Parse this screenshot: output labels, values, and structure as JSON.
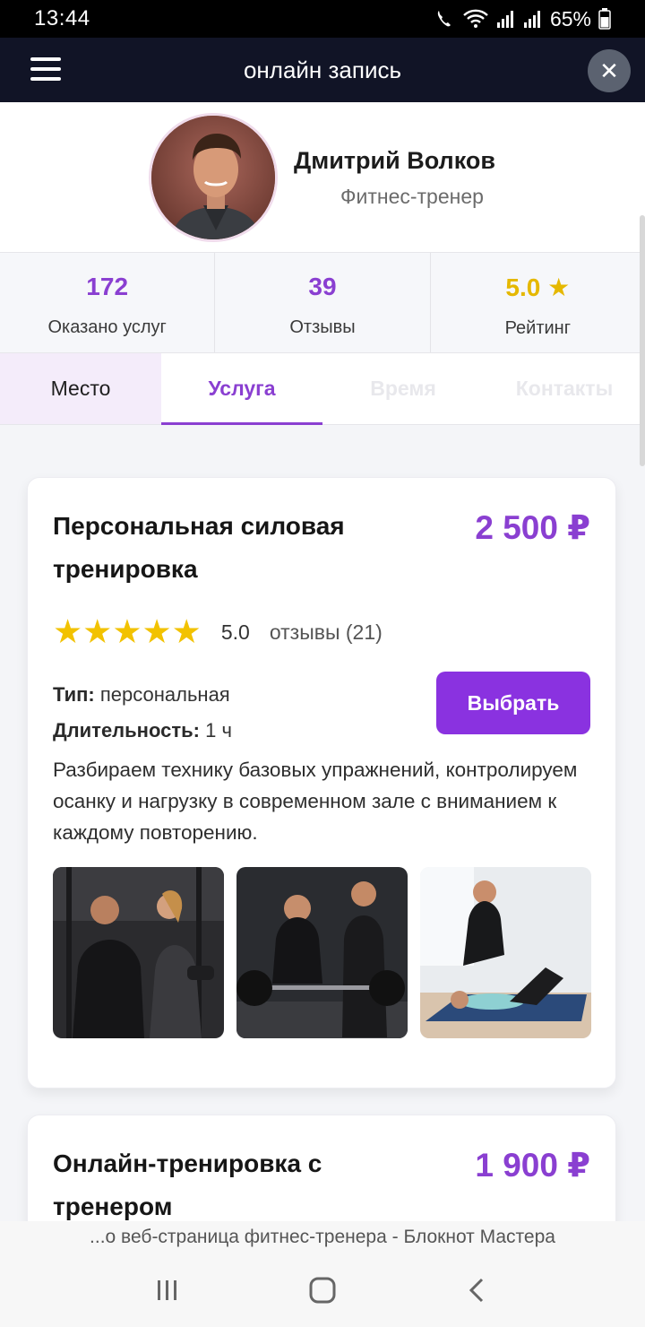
{
  "status_bar": {
    "time": "13:44",
    "battery": "65%"
  },
  "header": {
    "title": "онлайн запись",
    "close_symbol": "✕"
  },
  "profile": {
    "name": "Дмитрий Волков",
    "role": "Фитнес-тренер"
  },
  "stats": [
    {
      "value": "172",
      "label": "Оказано услуг"
    },
    {
      "value": "39",
      "label": "Отзывы"
    },
    {
      "value": "5.0 ★",
      "label": "Рейтинг"
    }
  ],
  "tabs": [
    {
      "label": "Место",
      "state": "completed"
    },
    {
      "label": "Услуга",
      "state": "active"
    },
    {
      "label": "Время",
      "state": "disabled"
    },
    {
      "label": "Контакты",
      "state": "disabled"
    }
  ],
  "services": [
    {
      "title": "Персональная силовая тренировка",
      "price": "2 500 ₽",
      "stars": "★★★★★",
      "rating": "5.0",
      "reviews": "отзывы (21)",
      "type_label": "Тип:",
      "type_value": "персональная",
      "duration_label": "Длительность:",
      "duration_value": "1 ч",
      "button": "Выбрать",
      "description": "Разбираем технику базовых упражнений, контролируем осанку и нагрузку в современном зале с вниманием к каждому повторению."
    },
    {
      "title": "Онлайн-тренировка с тренером",
      "price": "1 900 ₽"
    }
  ],
  "browser_bar": {
    "text": "...о веб-страница фитнес-тренера - Блокнот Мастера"
  },
  "colors": {
    "accent": "#8a3fd1",
    "header_bg": "#111426",
    "star": "#f2c200",
    "button": "#8a32e0"
  }
}
